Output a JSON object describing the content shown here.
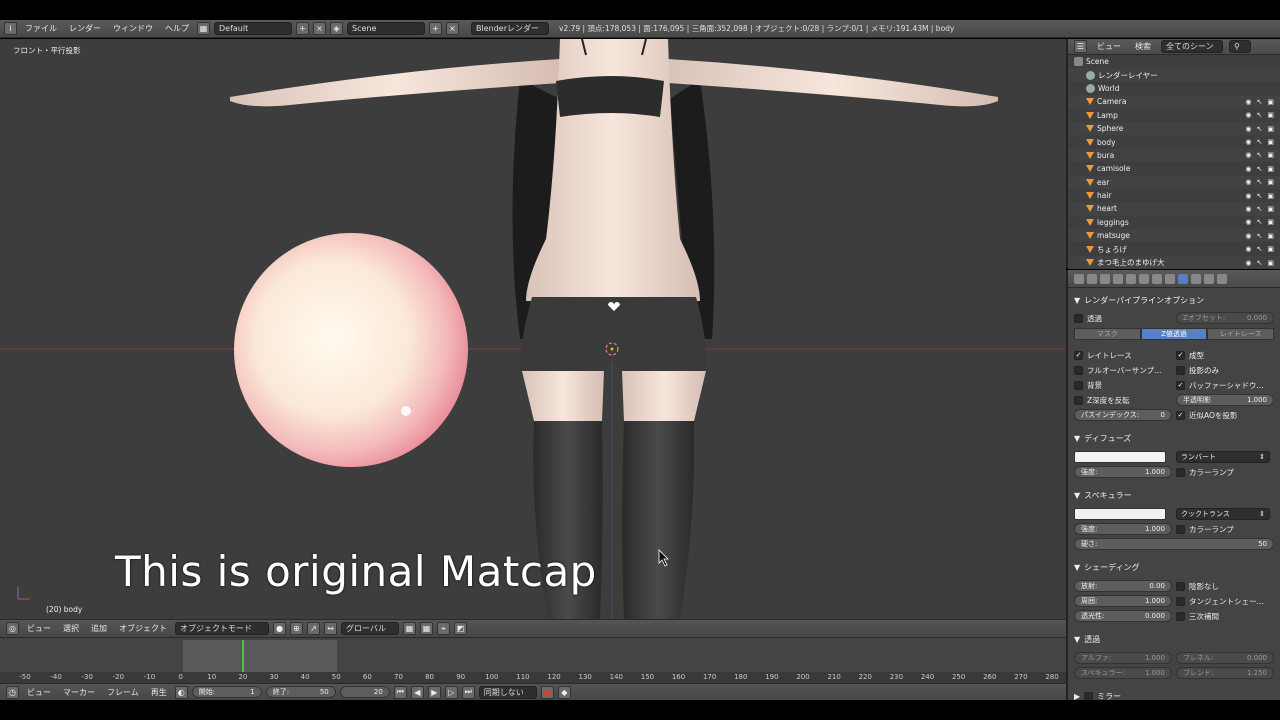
{
  "header": {
    "menus": [
      "ファイル",
      "レンダー",
      "ウィンドウ",
      "ヘルプ"
    ],
    "layout": "Default",
    "scene": "Scene",
    "engine": "Blenderレンダー",
    "stats": "v2.79 | 頂点:178,053 | 面:176,095 | 三角面:352,098 | オブジェクト:0/28 | ランプ:0/1 | メモリ:191.43M | body"
  },
  "viewport": {
    "view_label": "フロント・平行投影",
    "object_label": "(20) body",
    "caption": "This is original Matcap"
  },
  "view_toolbar": {
    "items": [
      "ビュー",
      "選択",
      "追加",
      "オブジェクト"
    ],
    "mode": "オブジェクトモード",
    "orientation": "グローバル"
  },
  "timeline": {
    "ticks": [
      "-50",
      "-40",
      "-30",
      "-20",
      "-10",
      "0",
      "10",
      "20",
      "30",
      "40",
      "50",
      "60",
      "70",
      "80",
      "90",
      "100",
      "110",
      "120",
      "130",
      "140",
      "150",
      "160",
      "170",
      "180",
      "190",
      "200",
      "210",
      "220",
      "230",
      "240",
      "250",
      "260",
      "270",
      "280"
    ],
    "items": [
      "ビュー",
      "マーカー",
      "フレーム",
      "再生"
    ],
    "start_label": "開始:",
    "start": "1",
    "end_label": "終了:",
    "end": "50",
    "current": "20",
    "sync": "同期しない"
  },
  "outliner": {
    "menus": [
      "ビュー",
      "検索"
    ],
    "filter": "全てのシーン",
    "rows": [
      {
        "name": "Scene",
        "indent": 0
      },
      {
        "name": "レンダーレイヤー",
        "indent": 1
      },
      {
        "name": "World",
        "indent": 1
      },
      {
        "name": "Camera",
        "indent": 1
      },
      {
        "name": "Lamp",
        "indent": 1
      },
      {
        "name": "Sphere",
        "indent": 1
      },
      {
        "name": "body",
        "indent": 1
      },
      {
        "name": "bura",
        "indent": 1
      },
      {
        "name": "camisole",
        "indent": 1
      },
      {
        "name": "ear",
        "indent": 1
      },
      {
        "name": "hair",
        "indent": 1
      },
      {
        "name": "heart",
        "indent": 1
      },
      {
        "name": "leggings",
        "indent": 1
      },
      {
        "name": "matsuge",
        "indent": 1
      },
      {
        "name": "ちょろげ",
        "indent": 1
      },
      {
        "name": "まつ毛上のまゆげ大",
        "indent": 1
      }
    ]
  },
  "properties": {
    "pipeline": {
      "title": "レンダーパイプラインオプション",
      "transparency": "透過",
      "z_offset_label": "Zオフセット:",
      "z_offset": "0.000",
      "modes": [
        "マスク",
        "Z値透過",
        "レイトレース"
      ],
      "raytrace": "レイトレース",
      "full_oversample": "フルオーバーサンプ…",
      "sky": "背景",
      "invert_z": "Z深度を反転",
      "pass_index_label": "パスインデックス:",
      "pass_index": "0",
      "cast": "成型",
      "cast_only": "投影のみ",
      "buffer_shadow": "バッファーシャドウ…",
      "translucency_label": "半透明影",
      "translucency": "1.000",
      "approx_ao": "近似AOを投影"
    },
    "diffuse": {
      "title": "ディフューズ",
      "shader": "ランバート",
      "intensity_label": "強度:",
      "intensity": "1.000",
      "ramp": "カラーランプ"
    },
    "specular": {
      "title": "スペキュラー",
      "shader": "クックトランス",
      "intensity_label": "強度:",
      "intensity": "1.000",
      "ramp": "カラーランプ",
      "hardness_label": "硬さ:",
      "hardness": "50"
    },
    "shading": {
      "title": "シェーディング",
      "emit_label": "放射:",
      "emit": "0.00",
      "ambient_label": "周囲:",
      "ambient": "1.000",
      "translucency_label": "透光性:",
      "translucency": "0.000",
      "shadeless": "陰影なし",
      "tangent": "タンジェントシェー…",
      "cubic": "三次補間"
    },
    "transparency": {
      "title": "透過",
      "alpha_label": "アルファ:",
      "alpha": "1.000",
      "fresnel_label": "フレネル:",
      "fresnel": "0.000",
      "specular_label": "スペキュラー:",
      "specular": "1.000",
      "blend_label": "ブレンド:",
      "blend": "1.250"
    },
    "mirror": {
      "title": "ミラー"
    }
  }
}
